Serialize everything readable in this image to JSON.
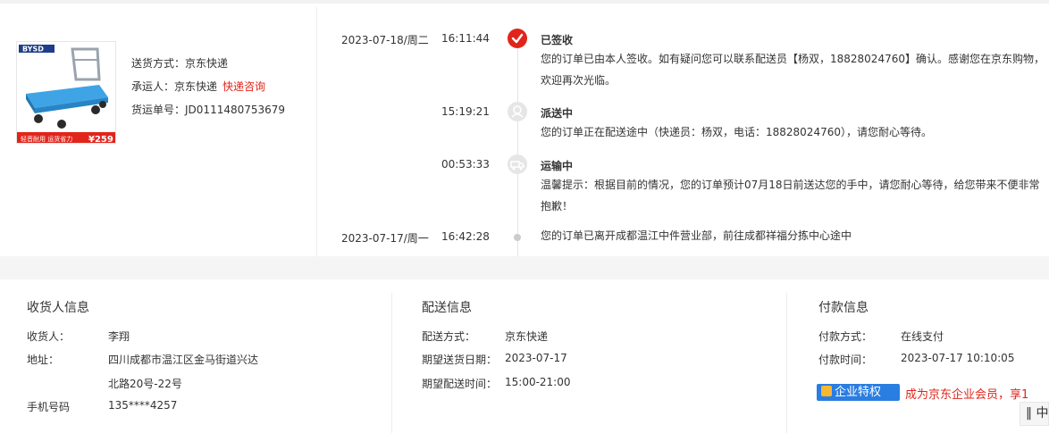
{
  "product": {
    "brand_logo_text": "BYSD",
    "promo_text": "轻音耐用 运货省力",
    "price": "¥259"
  },
  "shipping": {
    "method_label": "送货方式：",
    "method_value": "京东快递",
    "carrier_label": "承运人：",
    "carrier_value": "京东快递",
    "carrier_link": "快递咨询",
    "tracking_label": "货运单号：",
    "tracking_value": "JD0111480753679"
  },
  "timeline": [
    {
      "date": "2023-07-18/周二",
      "time": "16:11:44",
      "status": "已签收",
      "desc": "您的订单已由本人签收。如有疑问您可以联系配送员【杨双，18828024760】确认。感谢您在京东购物，欢迎再次光临。",
      "icon": "check-icon"
    },
    {
      "date": "",
      "time": "15:19:21",
      "status": "派送中",
      "desc": "您的订单正在配送途中（快递员：杨双，电话：18828024760），请您耐心等待。",
      "icon": "courier-icon"
    },
    {
      "date": "",
      "time": "00:53:33",
      "status": "运输中",
      "desc": "温馨提示：根据目前的情况，您的订单预计07月18日前送达您的手中，请您耐心等待，给您带来不便非常抱歉！",
      "icon": "truck-icon"
    },
    {
      "date": "2023-07-17/周一",
      "time": "16:42:28",
      "status": "",
      "desc": "您的订单已离开成都温江中件营业部，前往成都祥福分拣中心途中",
      "icon": "dot-icon"
    }
  ],
  "receiver": {
    "title": "收货人信息",
    "name_label": "收货人：",
    "name_value": "李翔",
    "addr_label": "地址：",
    "addr_line1": "四川成都市温江区金马街道兴达",
    "addr_line2": "北路20号-22号",
    "phone_label": "手机号码",
    "phone_value": "135****4257"
  },
  "delivery": {
    "title": "配送信息",
    "method_label": "配送方式：",
    "method_value": "京东快递",
    "date_label": "期望送货日期：",
    "date_value": "2023-07-17",
    "time_label": "期望配送时间：",
    "time_value": "15:00-21:00"
  },
  "payment": {
    "title": "付款信息",
    "method_label": "付款方式：",
    "method_value": "在线支付",
    "time_label": "付款时间：",
    "time_value": "2023-07-17 10:10:05"
  },
  "enterprise": {
    "badge": "企业特权",
    "promo": "成为京东企业会员，享1",
    "side_tab": "‖ 中"
  },
  "colors": {
    "accent_red": "#e1251b",
    "badge_blue": "#2a7de1"
  }
}
